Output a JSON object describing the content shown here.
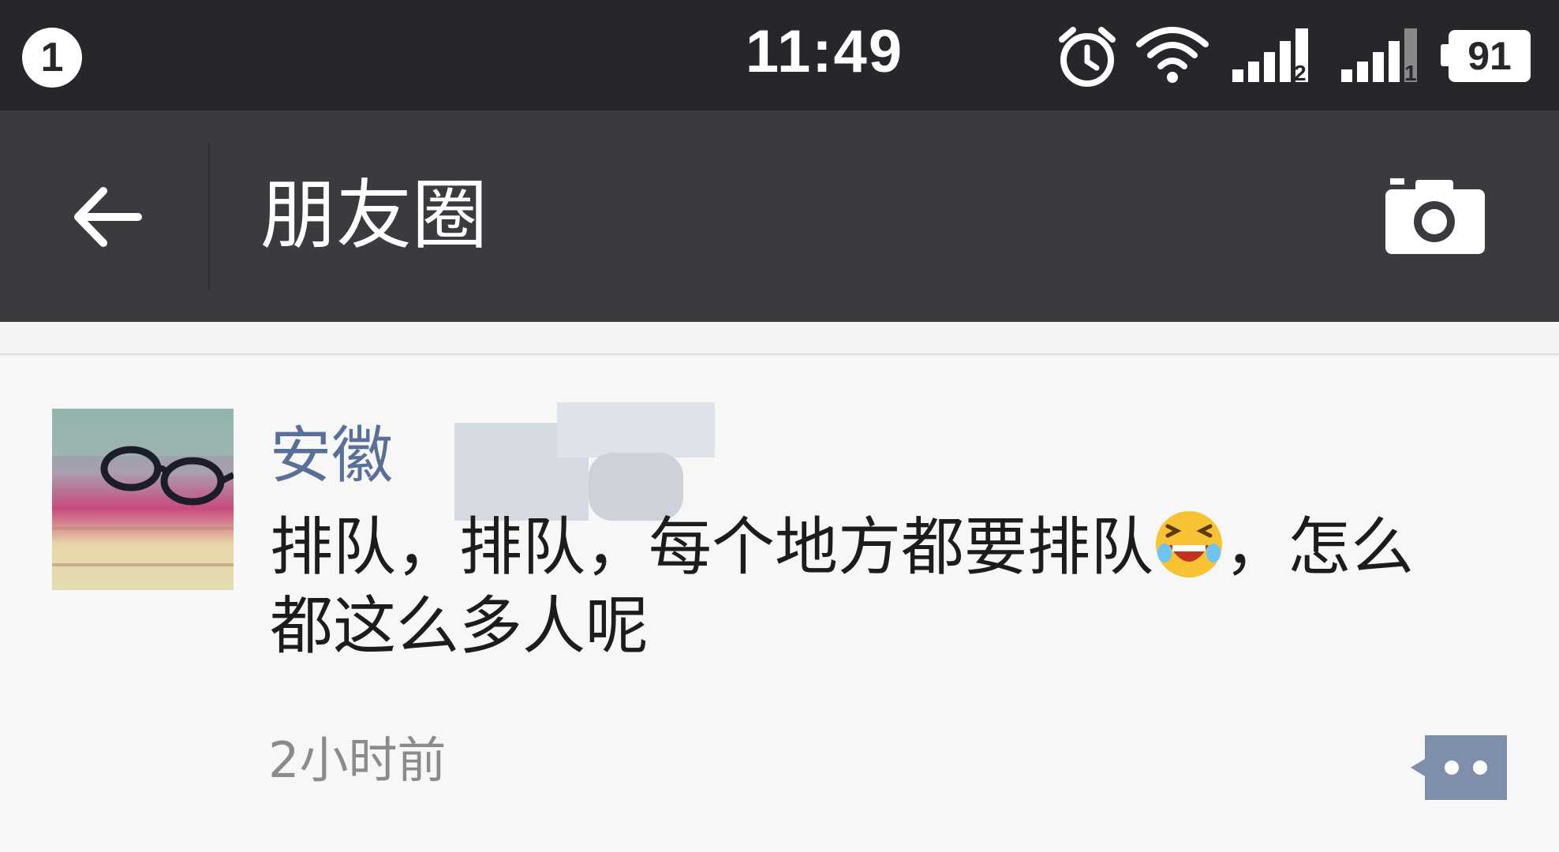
{
  "status_bar": {
    "notification_count": "1",
    "time": "11:49",
    "icons": [
      "alarm-icon",
      "wifi-icon",
      "signal-sim2-icon",
      "signal-sim1-icon",
      "battery-icon"
    ],
    "sim1_label": "1",
    "sim2_label": "2",
    "battery_level": "91"
  },
  "nav": {
    "back_icon": "arrow-left-icon",
    "title": "朋友圈",
    "camera_icon": "camera-icon"
  },
  "post": {
    "author_visible": "安徽",
    "author_redacted": true,
    "text_line1_a": "排队，排队，每个地方都要排队",
    "emoji": "laughing-crying-face-icon",
    "text_line1_b": "，怎么",
    "text_line2": "都这么多人呢",
    "timestamp": "2小时前",
    "comment_icon": "comment-bubble-icon"
  },
  "colors": {
    "status_bar_bg": "#26272b",
    "nav_bar_bg": "#3a3b3f",
    "feed_bg": "#f7f7f7",
    "author_link": "#5a6f98",
    "comment_button": "#7f8fab"
  }
}
